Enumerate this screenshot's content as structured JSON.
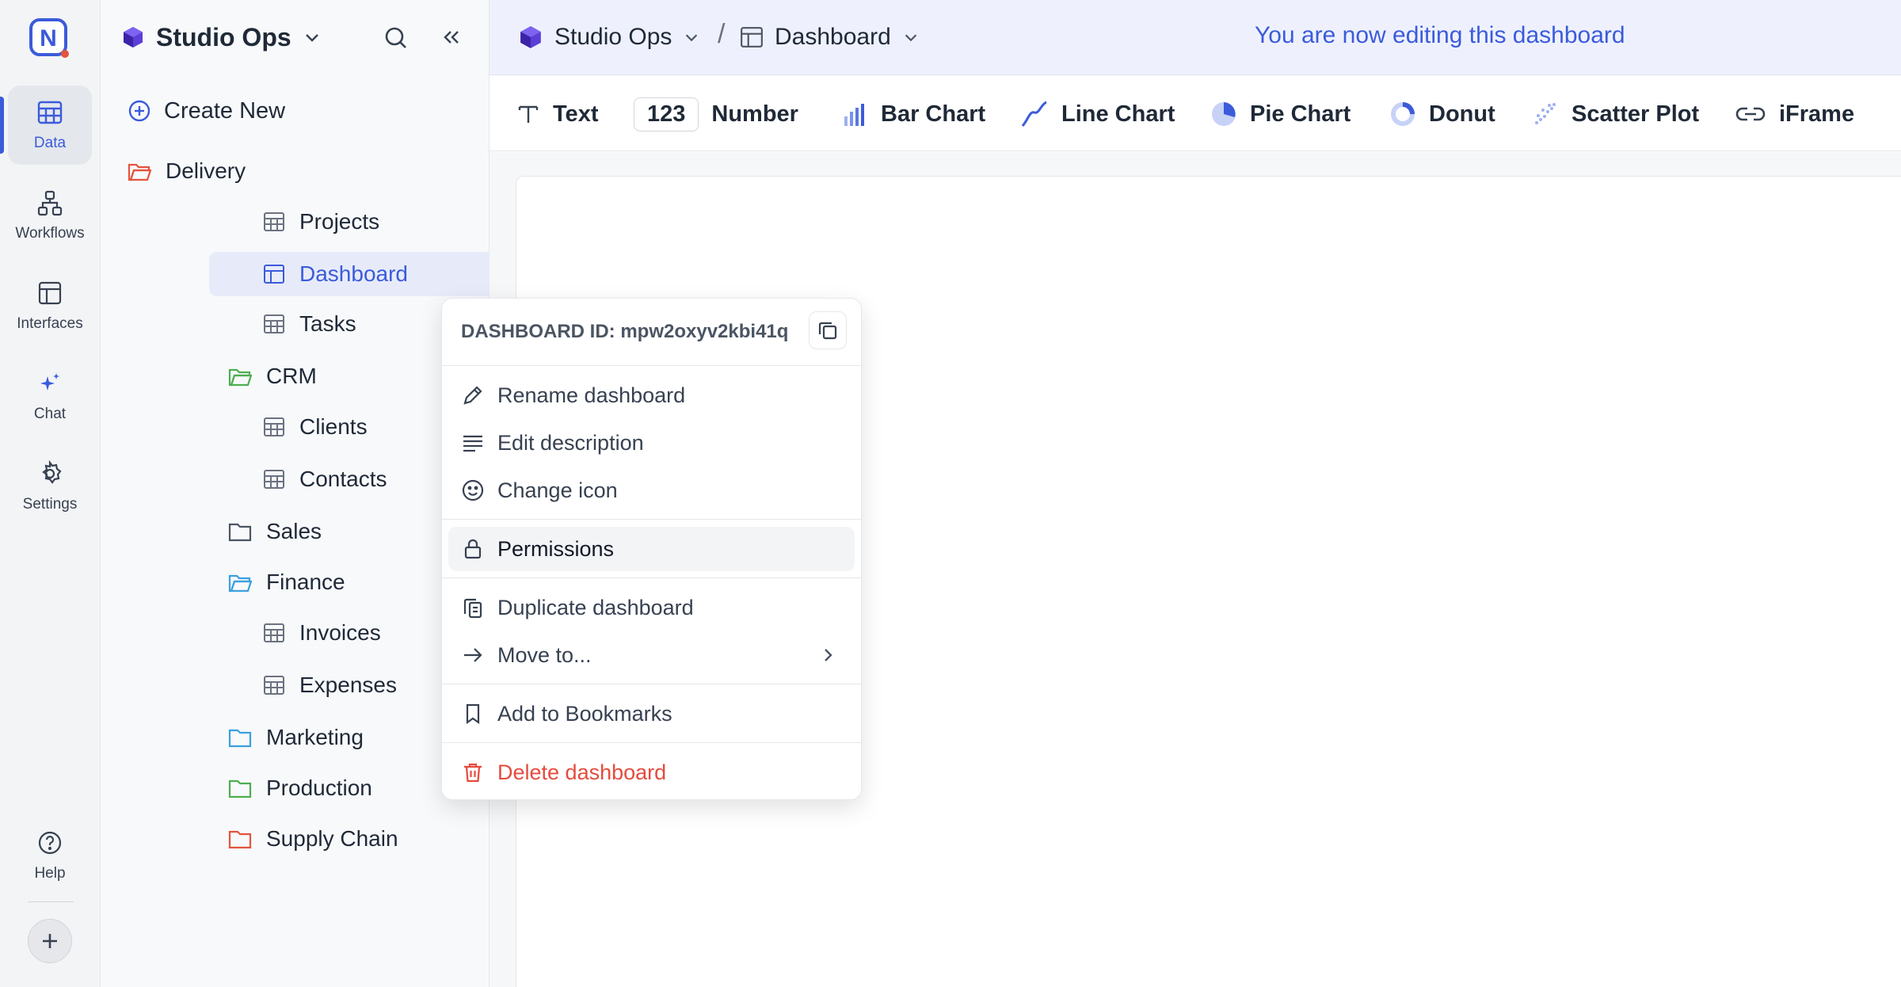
{
  "rail": {
    "items": [
      {
        "label": "Data",
        "icon": "table-icon"
      },
      {
        "label": "Workflows",
        "icon": "workflow-icon"
      },
      {
        "label": "Interfaces",
        "icon": "layout-icon"
      },
      {
        "label": "Chat",
        "icon": "sparkles-icon"
      },
      {
        "label": "Settings",
        "icon": "gear-icon"
      }
    ],
    "help_label": "Help",
    "logo_letter": "N"
  },
  "sidebar": {
    "workspace_name": "Studio Ops",
    "create_new": "Create New",
    "tree": [
      {
        "label": "Delivery",
        "type": "folder",
        "color": "#e5533d"
      },
      {
        "label": "Projects",
        "type": "table"
      },
      {
        "label": "Dashboard",
        "type": "dashboard",
        "selected": true
      },
      {
        "label": "Tasks",
        "type": "table"
      },
      {
        "label": "CRM",
        "type": "folder",
        "color": "#4caf50"
      },
      {
        "label": "Clients",
        "type": "table"
      },
      {
        "label": "Contacts",
        "type": "table"
      },
      {
        "label": "Sales",
        "type": "folder",
        "color": "#6b7280"
      },
      {
        "label": "Finance",
        "type": "folder",
        "color": "#3aa0e0"
      },
      {
        "label": "Invoices",
        "type": "table"
      },
      {
        "label": "Expenses",
        "type": "table"
      },
      {
        "label": "Marketing",
        "type": "folder",
        "color": "#3aa0e0"
      },
      {
        "label": "Production",
        "type": "folder",
        "color": "#4caf50"
      },
      {
        "label": "Supply Chain",
        "type": "folder",
        "color": "#e5533d"
      }
    ]
  },
  "topbar": {
    "breadcrumb_workspace": "Studio Ops",
    "breadcrumb_separator": "/",
    "breadcrumb_page": "Dashboard",
    "edit_banner": "You are now editing this dashboard"
  },
  "toolbar": {
    "items": [
      {
        "label": "Text",
        "icon": "text-icon"
      },
      {
        "label": "Number",
        "icon": "number-chip",
        "chip": "123"
      },
      {
        "label": "Bar Chart",
        "icon": "bar-chart-icon"
      },
      {
        "label": "Line Chart",
        "icon": "line-chart-icon"
      },
      {
        "label": "Pie Chart",
        "icon": "pie-chart-icon"
      },
      {
        "label": "Donut",
        "icon": "donut-icon"
      },
      {
        "label": "Scatter Plot",
        "icon": "scatter-plot-icon"
      },
      {
        "label": "iFrame",
        "icon": "link-icon"
      }
    ]
  },
  "context_menu": {
    "header": "DASHBOARD ID: mpw2oxyv2kbi41q",
    "items": [
      {
        "label": "Rename dashboard",
        "icon": "pencil-icon"
      },
      {
        "label": "Edit description",
        "icon": "lines-icon"
      },
      {
        "label": "Change icon",
        "icon": "smiley-icon"
      },
      {
        "label": "Permissions",
        "icon": "lock-icon",
        "hovered": true
      },
      {
        "label": "Duplicate dashboard",
        "icon": "duplicate-icon"
      },
      {
        "label": "Move to...",
        "icon": "arrow-right-icon",
        "submenu": true
      },
      {
        "label": "Add to Bookmarks",
        "icon": "bookmark-icon"
      },
      {
        "label": "Delete dashboard",
        "icon": "trash-icon",
        "danger": true
      }
    ]
  },
  "colors": {
    "accent": "#3b5bdb",
    "danger": "#e54b3d",
    "workspace_cube": "#5b3fd6"
  }
}
